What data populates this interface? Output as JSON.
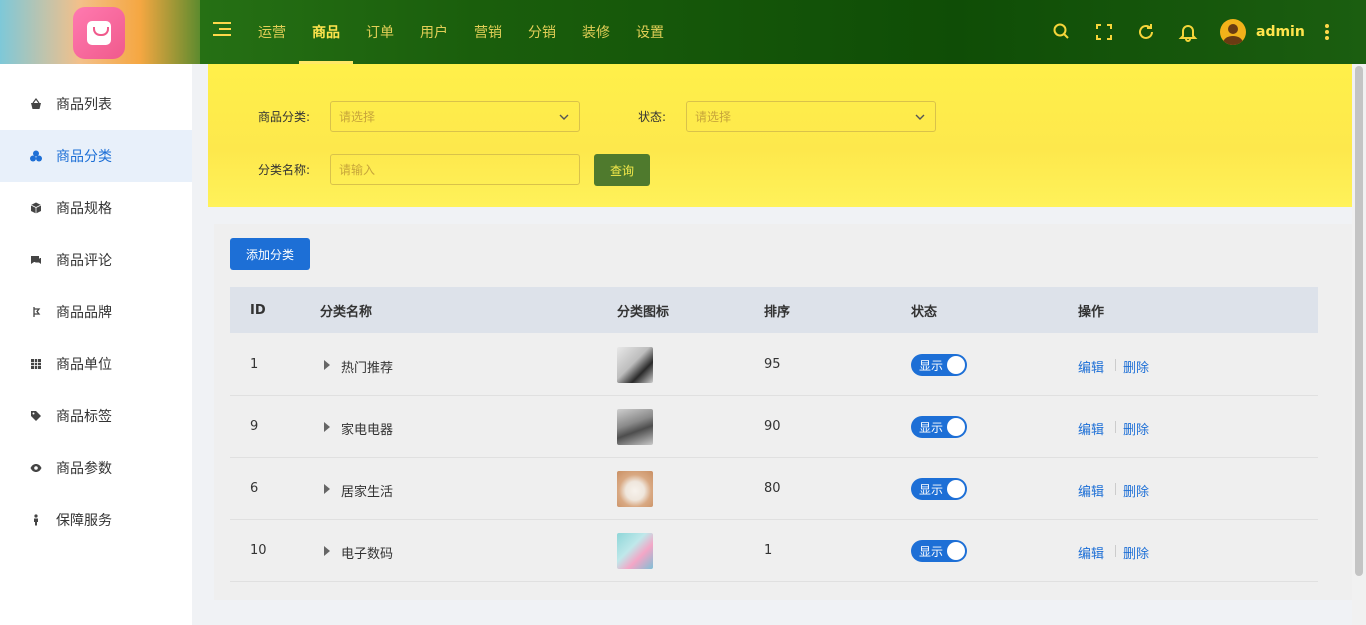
{
  "header": {
    "nav": [
      {
        "label": "运营",
        "active": false
      },
      {
        "label": "商品",
        "active": true
      },
      {
        "label": "订单",
        "active": false
      },
      {
        "label": "用户",
        "active": false
      },
      {
        "label": "营销",
        "active": false
      },
      {
        "label": "分销",
        "active": false
      },
      {
        "label": "装修",
        "active": false
      },
      {
        "label": "设置",
        "active": false
      }
    ],
    "icons": [
      "search-icon",
      "fullscreen-icon",
      "refresh-icon",
      "bell-icon"
    ],
    "username": "admin"
  },
  "sidebar": {
    "items": [
      {
        "label": "商品列表",
        "icon": "basket-icon",
        "active": false
      },
      {
        "label": "商品分类",
        "icon": "category-icon",
        "active": true
      },
      {
        "label": "商品规格",
        "icon": "cube-icon",
        "active": false
      },
      {
        "label": "商品评论",
        "icon": "comment-icon",
        "active": false
      },
      {
        "label": "商品品牌",
        "icon": "brand-icon",
        "active": false
      },
      {
        "label": "商品单位",
        "icon": "grid-icon",
        "active": false
      },
      {
        "label": "商品标签",
        "icon": "tag-icon",
        "active": false
      },
      {
        "label": "商品参数",
        "icon": "eye-icon",
        "active": false
      },
      {
        "label": "保障服务",
        "icon": "shield-icon",
        "active": false
      }
    ]
  },
  "filter": {
    "category_label": "商品分类:",
    "category_placeholder": "请选择",
    "status_label": "状态:",
    "status_placeholder": "请选择",
    "name_label": "分类名称:",
    "name_placeholder": "请输入",
    "query_button": "查询"
  },
  "toolbar": {
    "add_button": "添加分类"
  },
  "table": {
    "columns": [
      "ID",
      "分类名称",
      "分类图标",
      "排序",
      "状态",
      "操作"
    ],
    "rows": [
      {
        "id": "1",
        "name": "热门推荐",
        "sort": "95",
        "status": "显示"
      },
      {
        "id": "9",
        "name": "家电电器",
        "sort": "90",
        "status": "显示"
      },
      {
        "id": "6",
        "name": "居家生活",
        "sort": "80",
        "status": "显示"
      },
      {
        "id": "10",
        "name": "电子数码",
        "sort": "1",
        "status": "显示"
      }
    ],
    "edit_label": "编辑",
    "delete_label": "删除"
  },
  "colors": {
    "primary": "#1d6fd6",
    "header": "#1a5e0c",
    "filter": "#fde84c",
    "query_button": "#4f7a2d"
  }
}
